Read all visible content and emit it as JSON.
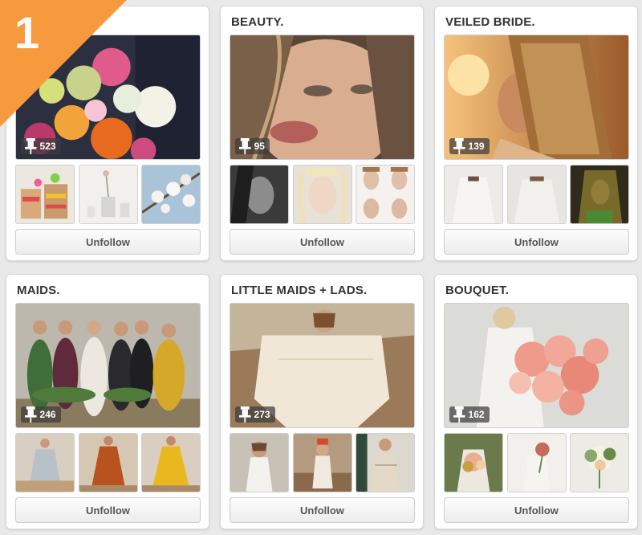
{
  "ribbon": {
    "rank": "1",
    "color": "#f79a3e"
  },
  "boards": [
    {
      "title": "",
      "pin_count": "523",
      "button_label": "Unfollow"
    },
    {
      "title": "BEAUTY.",
      "pin_count": "95",
      "button_label": "Unfollow"
    },
    {
      "title": "VEILED BRIDE.",
      "pin_count": "139",
      "button_label": "Unfollow"
    },
    {
      "title": "MAIDS.",
      "pin_count": "246",
      "button_label": "Unfollow"
    },
    {
      "title": "LITTLE MAIDS + LADS.",
      "pin_count": "273",
      "button_label": "Unfollow"
    },
    {
      "title": "BOUQUET.",
      "pin_count": "162",
      "button_label": "Unfollow"
    }
  ],
  "icons": {
    "pin": "pushpin-icon"
  },
  "colors": {
    "background": "#e9e9e9",
    "card": "#ffffff",
    "title": "#333333",
    "button_text": "#555555"
  }
}
